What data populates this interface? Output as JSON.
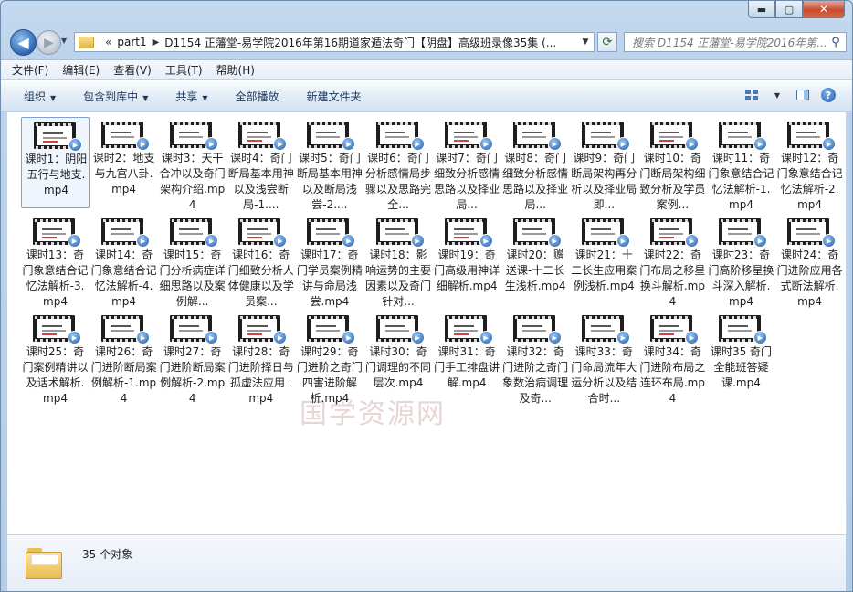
{
  "window": {
    "caption": {
      "minimize": "▬",
      "maximize": "▢",
      "close": "✕"
    }
  },
  "nav": {
    "back": "◀",
    "forward": "▶",
    "address": {
      "chevron": "«",
      "crumb1": "part1",
      "separator": "▶",
      "crumb2": "D1154 正藩堂-易学院2016年第16期道家遁法奇门【阴盘】高级班录像35集 (..."
    },
    "refresh": "⟳",
    "search_placeholder": "搜索 D1154 正藩堂-易学院2016年第..."
  },
  "menu": [
    "文件(F)",
    "编辑(E)",
    "查看(V)",
    "工具(T)",
    "帮助(H)"
  ],
  "toolbar": {
    "organize": "组织",
    "include_in_library": "包含到库中",
    "share": "共享",
    "play_all": "全部播放",
    "new_folder": "新建文件夹"
  },
  "files": [
    "课时1：阴阳五行与地支.mp4",
    "课时2：地支与九宫八卦.mp4",
    "课时3：天干合冲以及奇门架构介绍.mp4",
    "课时4：奇门断局基本用神以及浅尝断局-1....",
    "课时5：奇门断局基本用神以及断局浅尝-2....",
    "课时6：奇门分析感情局步骤以及思路完全...",
    "课时7：奇门细致分析感情思路以及择业局...",
    "课时8：奇门细致分析感情思路以及择业局...",
    "课时9：奇门断局架构再分析以及择业局即...",
    "课时10：奇门断局架构细致分析及学员案例...",
    "课时11：奇门象意结合记忆法解析-1.mp4",
    "课时12：奇门象意结合记忆法解析-2.mp4",
    "课时13：奇门象意结合记忆法解析-3.mp4",
    "课时14：奇门象意结合记忆法解析-4.mp4",
    "课时15：奇门分析病症详细思路以及案例解...",
    "课时16：奇门细致分析人体健康以及学员案...",
    "课时17：奇门学员案例精讲与命局浅尝.mp4",
    "课时18：影响运势的主要因素以及奇门针对...",
    "课时19：奇门高级用神详细解析.mp4",
    "课时20：赠送课-十二长生浅析.mp4",
    "课时21：十二长生应用案例浅析.mp4",
    "课时22：奇门布局之移星换斗解析.mp4",
    "课时23：奇门高阶移星换斗深入解析.mp4",
    "课时24：奇门进阶应用各式断法解析.mp4",
    "课时25：奇门案例精讲以及话术解析.mp4",
    "课时26：奇门进阶断局案例解析-1.mp4",
    "课时27：奇门进阶断局案例解析-2.mp4",
    "课时28：奇门进阶择日与孤虚法应用 .mp4",
    "课时29：奇门进阶之奇门四害进阶解析.mp4",
    "课时30：奇门调理的不同层次.mp4",
    "课时31：奇门手工排盘讲解.mp4",
    "课时32：奇门进阶之奇门象数治病调理及奇...",
    "课时33：奇门命局流年大运分析以及结合时...",
    "课时34：奇门进阶布局之连环布局.mp4",
    "课时35 奇门全能班答疑课.mp4"
  ],
  "details": {
    "count": "35 个对象"
  },
  "watermark": "国学资源网"
}
